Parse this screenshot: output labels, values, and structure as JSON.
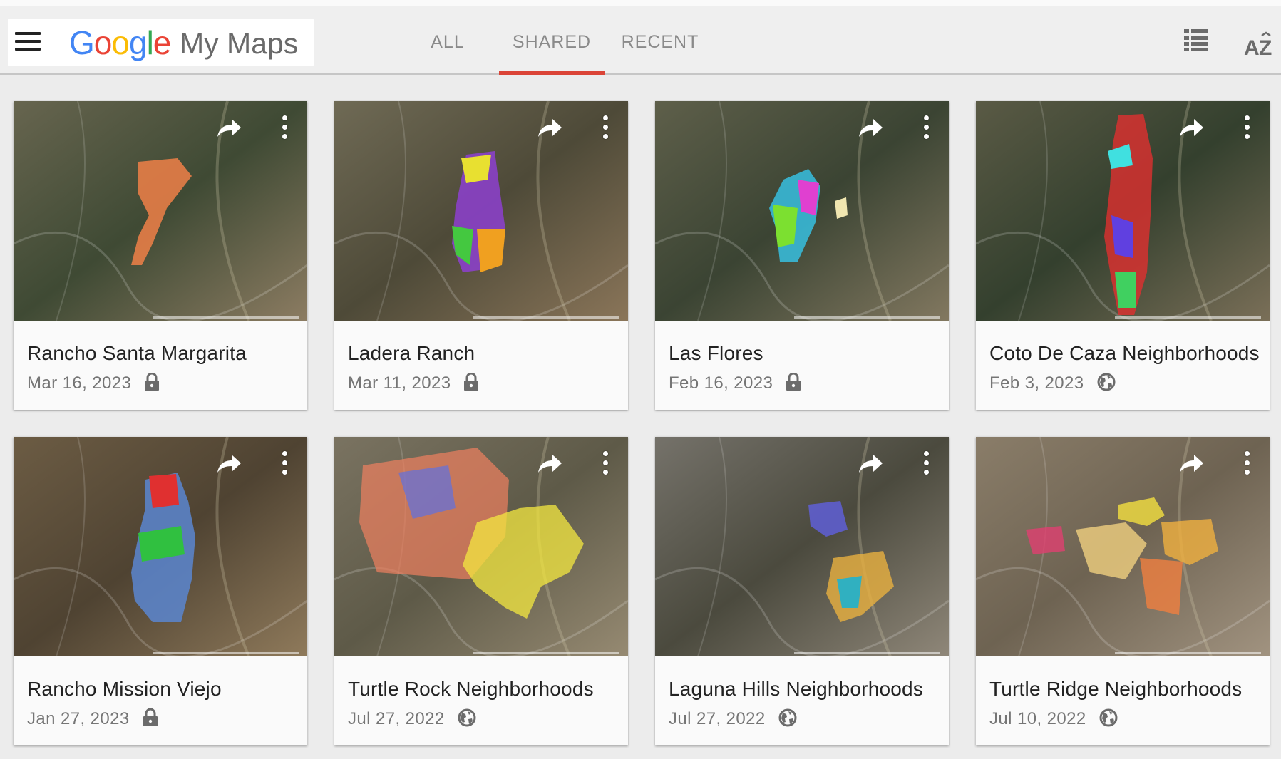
{
  "header": {
    "logo_text": "Google",
    "app_name": "My Maps",
    "tabs": [
      {
        "label": "ALL",
        "active": false
      },
      {
        "label": "SHARED",
        "active": true
      },
      {
        "label": "RECENT",
        "active": false
      }
    ],
    "icons": [
      "menu-icon",
      "list-view-icon",
      "sort-az-icon"
    ],
    "accent_color": "#db4437"
  },
  "maps": [
    {
      "title": "Rancho Santa Margarita",
      "date": "Mar 16, 2023",
      "visibility": "private"
    },
    {
      "title": "Ladera Ranch",
      "date": "Mar 11, 2023",
      "visibility": "private"
    },
    {
      "title": "Las Flores",
      "date": "Feb 16, 2023",
      "visibility": "private"
    },
    {
      "title": "Coto De Caza Neighborhoods",
      "date": "Feb 3, 2023",
      "visibility": "public"
    },
    {
      "title": "Rancho Mission Viejo",
      "date": "Jan 27, 2023",
      "visibility": "private"
    },
    {
      "title": "Turtle Rock Neighborhoods",
      "date": "Jul 27, 2022",
      "visibility": "public"
    },
    {
      "title": "Laguna Hills Neighborhoods",
      "date": "Jul 27, 2022",
      "visibility": "public"
    },
    {
      "title": "Turtle Ridge Neighborhoods",
      "date": "Jul 10, 2022",
      "visibility": "public"
    }
  ]
}
